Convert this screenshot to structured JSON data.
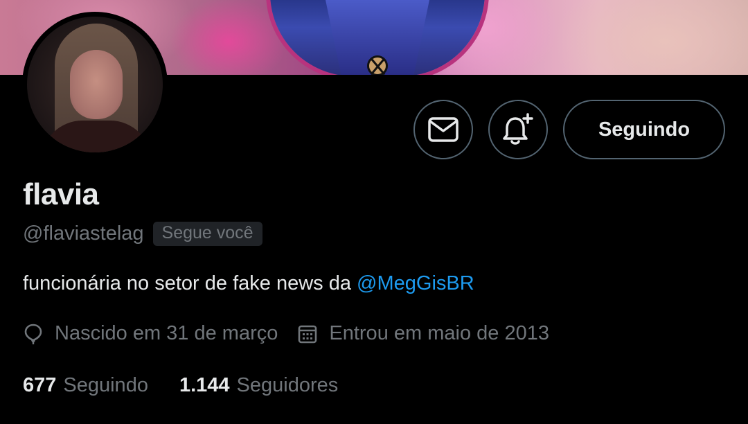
{
  "profile": {
    "display_name": "flavia",
    "handle": "@flaviastelag",
    "follows_you_badge": "Segue você",
    "bio_text": "funcionária no setor de fake news da ",
    "bio_mention": "@MegGisBR",
    "birthday": "Nascido em 31 de março",
    "joined": "Entrou em maio de 2013"
  },
  "actions": {
    "message_icon": "envelope-icon",
    "notify_icon": "bell-plus-icon",
    "following_label": "Seguindo"
  },
  "stats": {
    "following_count": "677",
    "following_label": "Seguindo",
    "followers_count": "1.144",
    "followers_label": "Seguidores"
  },
  "colors": {
    "background": "#000000",
    "text_primary": "#e7e9ea",
    "text_secondary": "#71767b",
    "accent_link": "#1d9bf0",
    "button_border": "#536471"
  }
}
